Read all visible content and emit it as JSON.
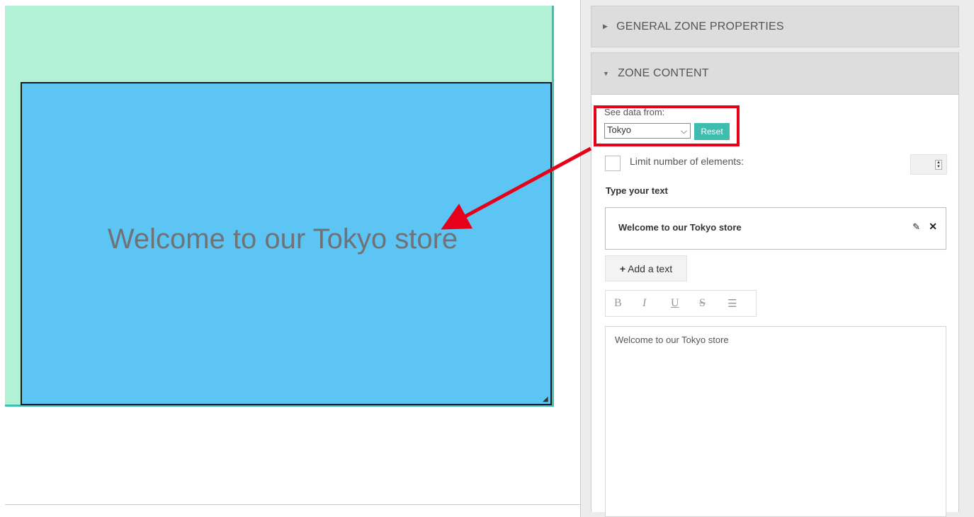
{
  "canvas": {
    "zone_text": "Welcome to our Tokyo store"
  },
  "panel": {
    "general_header": "GENERAL ZONE PROPERTIES",
    "content_header": "ZONE CONTENT",
    "see_data_label": "See data from:",
    "selected_location": "Tokyo",
    "reset_label": "Reset",
    "limit_label": "Limit number of elements:",
    "limit_checked": false,
    "type_text_label": "Type your text",
    "text_items": [
      {
        "label": "Welcome to our Tokyo store"
      }
    ],
    "add_text_label": "Add a text",
    "editor_value": "Welcome to our Tokyo store"
  },
  "icons": {
    "general_caret": "caret-right-icon",
    "content_caret": "caret-down-icon",
    "edit": "pencil-icon",
    "delete": "close-icon",
    "add": "plus-icon",
    "list": "list-icon"
  },
  "colors": {
    "background_zone": "#b3f1d6",
    "text_zone": "#5cc5f4",
    "accent": "#3ebcb0",
    "highlight": "#e6001a"
  }
}
